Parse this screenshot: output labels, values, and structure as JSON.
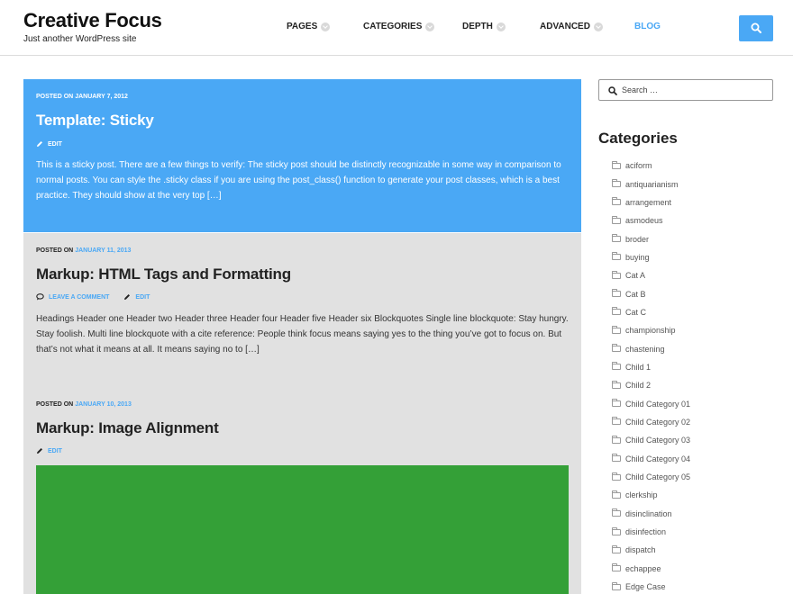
{
  "site": {
    "title": "Creative Focus",
    "description": "Just another WordPress site"
  },
  "nav": {
    "items": [
      {
        "label": "PAGES"
      },
      {
        "label": "CATEGORIES"
      },
      {
        "label": "DEPTH"
      },
      {
        "label": "ADVANCED"
      },
      {
        "label": "BLOG"
      }
    ],
    "active_color": "#4aa8f5"
  },
  "search_button_icon": "search-icon",
  "posts": [
    {
      "posted_on": "POSTED ON",
      "date": "JANUARY 7, 2012",
      "title": "Template: Sticky",
      "edit": "EDIT",
      "excerpt": "This is a sticky post. There are a few things to verify: The sticky post should be distinctly recognizable in some way in comparison to normal posts. You can style the .sticky class if you are using the post_class() function to generate your post classes, which is a best practice. They should show at the very top […]",
      "background": "#4aa8f5"
    },
    {
      "posted_on": "POSTED ON",
      "date": "JANUARY 11, 2013",
      "title": "Markup: HTML Tags and Formatting",
      "comment": "LEAVE A COMMENT",
      "edit": "EDIT",
      "excerpt": "Headings Header one Header two Header three Header four Header five Header six Blockquotes Single line blockquote: Stay hungry. Stay foolish. Multi line blockquote with a cite reference: People think focus means saying yes to the thing you’ve got to focus on. But that’s not what it means at all. It means saying no to […]",
      "background": "#e1e1e1"
    },
    {
      "posted_on": "POSTED ON",
      "date": "JANUARY 10, 2013",
      "title": "Markup: Image Alignment",
      "edit": "EDIT",
      "image_color": "#34a037"
    }
  ],
  "sidebar": {
    "search_placeholder": "Search …",
    "categories_title": "Categories",
    "categories": [
      "aciform",
      "antiquarianism",
      "arrangement",
      "asmodeus",
      "broder",
      "buying",
      "Cat A",
      "Cat B",
      "Cat C",
      "championship",
      "chastening",
      "Child 1",
      "Child 2",
      "Child Category 01",
      "Child Category 02",
      "Child Category 03",
      "Child Category 04",
      "Child Category 05",
      "clerkship",
      "disinclination",
      "disinfection",
      "dispatch",
      "echappee",
      "Edge Case"
    ]
  }
}
